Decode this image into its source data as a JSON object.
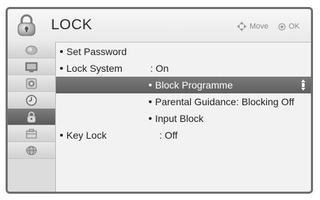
{
  "header": {
    "title": "LOCK",
    "move_hint": "Move",
    "ok_hint": "OK"
  },
  "sidebar": {
    "items": [
      {
        "icon": "picture-icon"
      },
      {
        "icon": "screen-icon"
      },
      {
        "icon": "audio-icon"
      },
      {
        "icon": "clock-icon"
      },
      {
        "icon": "lock-icon",
        "active": true
      },
      {
        "icon": "toolbox-icon"
      },
      {
        "icon": "globe-icon"
      }
    ]
  },
  "menu": {
    "set_password": "Set Password",
    "lock_system": {
      "label": "Lock System",
      "value": ": On"
    },
    "block_programme": "Block Programme",
    "parental_guidance": "Parental Guidance: Blocking Off",
    "input_block": "Input Block",
    "key_lock": {
      "label": "Key Lock",
      "value": ": Off"
    }
  },
  "colors": {
    "selected_bg": "#6a6a6a",
    "sidebar_active": "#5a5a5a"
  }
}
